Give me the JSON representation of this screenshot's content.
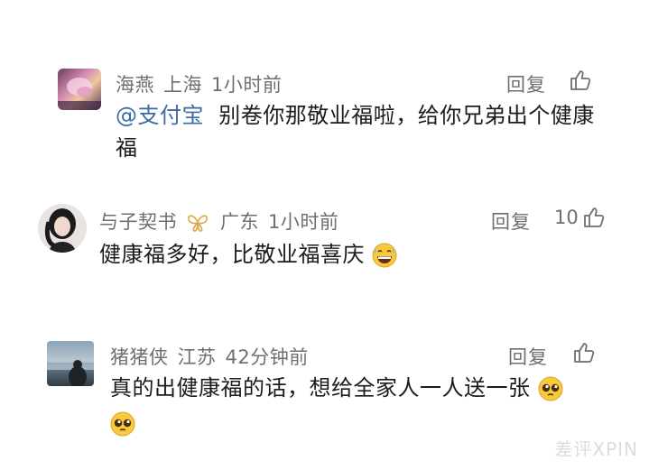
{
  "comments": [
    {
      "username": "海燕",
      "location": "上海",
      "time": "1小时前",
      "mention": "@支付宝",
      "text_line1": "别卷你那敬业福啦，给你兄弟出个健康",
      "text_line2": "福",
      "reply_label": "回复",
      "like_count": ""
    },
    {
      "username": "与子契书",
      "location": "广东",
      "time": "1小时前",
      "text": "健康福多好，比敬业福喜庆",
      "emoji": "grinning-sweat-emoji",
      "reply_label": "回复",
      "like_count": "10"
    },
    {
      "username": "猪猪侠",
      "location": "江苏",
      "time": "42分钟前",
      "text_line1": "真的出健康福的话，想给全家人一人送一张",
      "emoji": "pleading-face-emoji",
      "reply_label": "回复",
      "like_count": ""
    }
  ],
  "watermark": "差评XPIN",
  "colors": {
    "meta": "#6f6f6f",
    "mention": "#3a6aa8",
    "text": "#1c1c1c"
  }
}
